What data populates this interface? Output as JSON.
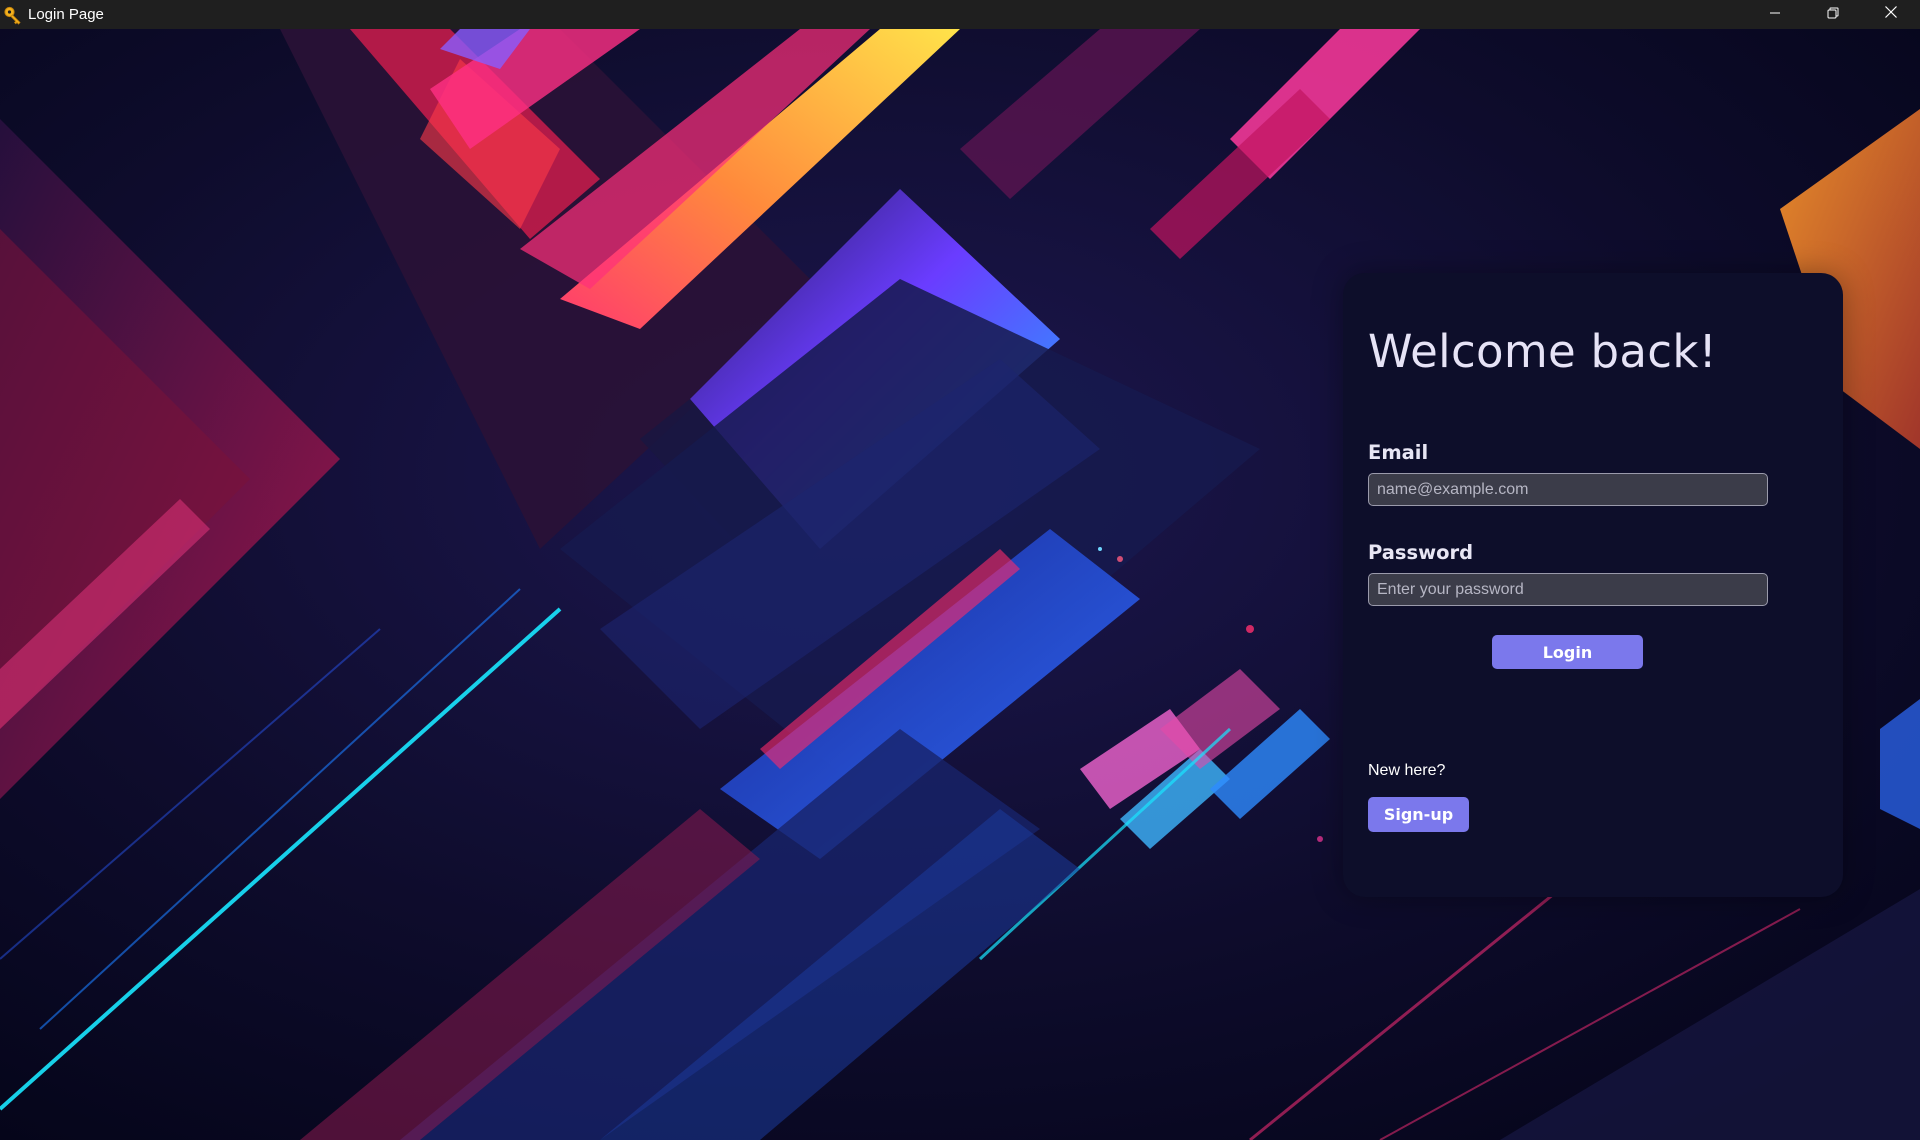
{
  "window": {
    "title": "Login Page",
    "icon": "key-icon",
    "controls": [
      "minimize-icon",
      "restore-icon",
      "close-icon"
    ]
  },
  "background": {
    "description_icon": "abstract-neon-blocks",
    "colors": [
      "#0a0a1e",
      "#ff2e88",
      "#ffd84a",
      "#19e0ff",
      "#6a3cff",
      "#1b2a8f",
      "#ff8a1f"
    ]
  },
  "login": {
    "heading": "Welcome back!",
    "email_label": "Email",
    "email_placeholder": "name@example.com",
    "email_value": "",
    "password_label": "Password",
    "password_placeholder": "Enter your password",
    "password_value": "",
    "login_button": "Login",
    "new_here": "New here?",
    "signup_button": "Sign-up"
  },
  "theme": {
    "card_bg": "#0d0e2a",
    "accent": "#7b78ec",
    "field_bg": "#3b3c49",
    "titlebar_bg": "#1f1f1f"
  }
}
